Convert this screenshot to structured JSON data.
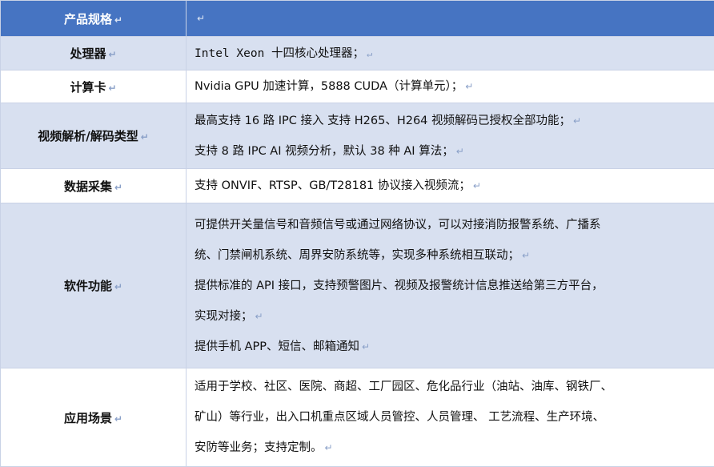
{
  "header": {
    "title": "产品规格",
    "mark": "↵",
    "value_mark": "↵"
  },
  "rows": {
    "processor": {
      "label": "处理器",
      "lines": [
        "Intel Xeon 十四核心处理器；"
      ]
    },
    "compute": {
      "label": "计算卡",
      "lines": [
        "Nvidia GPU 加速计算，5888 CUDA（计算单元）；"
      ]
    },
    "video": {
      "label": "视频解析/解码类型",
      "lines": [
        "最高支持 16 路 IPC 接入 支持 H265、H264 视频解码已授权全部功能；",
        "支持 8 路 IPC AI 视频分析，默认 38 种 AI 算法；"
      ]
    },
    "data": {
      "label": "数据采集",
      "lines": [
        "支持 ONVIF、RTSP、GB/T28181 协议接入视频流；"
      ]
    },
    "software": {
      "label": "软件功能",
      "lines": [
        "可提供开关量信号和音频信号或通过网络协议，可以对接消防报警系统、广播系",
        "统、门禁闸机系统、周界安防系统等，实现多种系统相互联动；",
        "提供标准的 API 接口，支持预警图片、视频及报警统计信息推送给第三方平台，",
        "实现对接；",
        "提供手机 APP、短信、邮箱通知"
      ]
    },
    "scenario": {
      "label": "应用场景",
      "lines": [
        "适用于学校、社区、医院、商超、工厂园区、危化品行业（油站、油库、钢铁厂、",
        "矿山）等行业，出入口机重点区域人员管控、人员管理、 工艺流程、生产环境、",
        "安防等业务；支持定制。"
      ]
    }
  },
  "colors": {
    "header_bg": "#4674c2",
    "alt_row_bg": "#d8e0f0",
    "border": "#c9d2e6"
  }
}
